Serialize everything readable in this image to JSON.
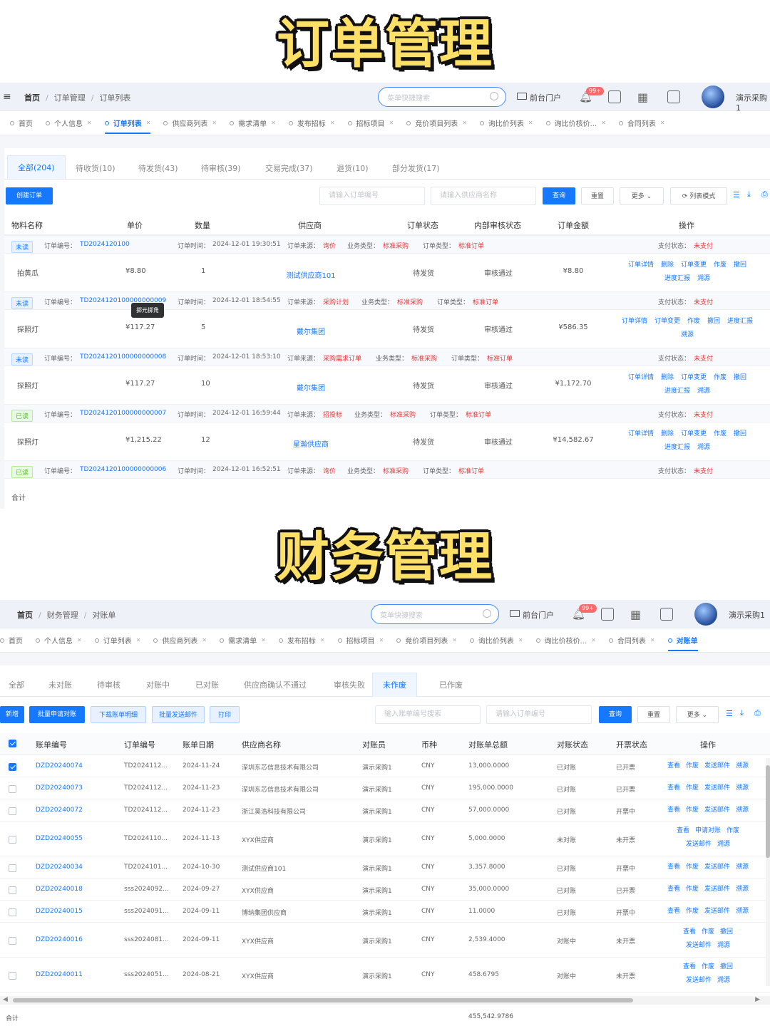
{
  "titles": {
    "order": "订单管理",
    "finance": "财务管理"
  },
  "order_panel": {
    "breadcrumb": [
      "首页",
      "订单管理",
      "订单列表"
    ],
    "search_placeholder": "菜单快捷搜索",
    "portal": "前台门户",
    "badge": "99+",
    "user": "演示采购1",
    "tabs": [
      {
        "label": "首页",
        "close": false
      },
      {
        "label": "个人信息",
        "close": true
      },
      {
        "label": "订单列表",
        "close": true,
        "active": true
      },
      {
        "label": "供应商列表",
        "close": true
      },
      {
        "label": "需求清单",
        "close": true
      },
      {
        "label": "发布招标",
        "close": true
      },
      {
        "label": "招标项目",
        "close": true
      },
      {
        "label": "竞价项目列表",
        "close": true
      },
      {
        "label": "询比价列表",
        "close": true
      },
      {
        "label": "询比价核价...",
        "close": true
      },
      {
        "label": "合同列表",
        "close": true
      }
    ],
    "status_tabs": [
      "全部(204)",
      "待收货(10)",
      "待发货(43)",
      "待审核(39)",
      "交易完成(37)",
      "退货(10)",
      "部分发货(17)"
    ],
    "create_btn": "创建订单",
    "order_no_placeholder": "请输入订单编号",
    "supplier_placeholder": "请输入供应商名称",
    "query": "查询",
    "reset": "重置",
    "more": "更多",
    "list_mode": "列表模式",
    "headers": [
      "物料名称",
      "单价",
      "数量",
      "供应商",
      "订单状态",
      "内部审核状态",
      "订单金额",
      "操作"
    ],
    "tooltip": "掷元掷角",
    "orders": [
      {
        "read_tag": "未读",
        "read": false,
        "order_no_label": "订单编号：",
        "order_no": "TD2024120100",
        "time_label": "订单时间：",
        "time": "2024-12-01 19:30:51",
        "source_label": "订单来源：",
        "source": "询价",
        "biz_label": "业务类型：",
        "biz": "标准采购",
        "type_label": "订单类型：",
        "type": "标准订单",
        "pay_label": "支付状态：",
        "pay": "未支付",
        "item": "拍黄瓜",
        "price": "¥8.80",
        "qty": "1",
        "supplier": "测试供应商101",
        "status": "待发货",
        "audit": "审核通过",
        "amount": "¥8.80",
        "ops": [
          [
            "订单详情",
            "删除",
            "订单变更",
            "作废",
            "撤回"
          ],
          [
            "进度汇报",
            "溯源"
          ]
        ]
      },
      {
        "read_tag": "未读",
        "read": false,
        "order_no_label": "订单编号：",
        "order_no": "TD2024120100000000009",
        "time_label": "订单时间：",
        "time": "2024-12-01 18:54:55",
        "source_label": "订单来源：",
        "source": "采购计划",
        "biz_label": "业务类型：",
        "biz": "标准采购",
        "type_label": "订单类型：",
        "type": "标准订单",
        "pay_label": "支付状态：",
        "pay": "未支付",
        "item": "探照灯",
        "price": "¥117.27",
        "qty": "5",
        "supplier": "戴尔集团",
        "status": "待发货",
        "audit": "审核通过",
        "amount": "¥586.35",
        "ops": [
          [
            "订单详情",
            "订单变更",
            "作废",
            "撤回",
            "进度汇报"
          ],
          [
            "溯源"
          ]
        ]
      },
      {
        "read_tag": "未读",
        "read": false,
        "order_no_label": "订单编号：",
        "order_no": "TD2024120100000000008",
        "time_label": "订单时间：",
        "time": "2024-12-01 18:53:10",
        "source_label": "订单来源：",
        "source": "采购需求订单",
        "biz_label": "业务类型：",
        "biz": "标准采购",
        "type_label": "订单类型：",
        "type": "标准订单",
        "pay_label": "支付状态：",
        "pay": "未支付",
        "item": "探照灯",
        "price": "¥117.27",
        "qty": "10",
        "supplier": "戴尔集团",
        "status": "待发货",
        "audit": "审核通过",
        "amount": "¥1,172.70",
        "ops": [
          [
            "订单详情",
            "删除",
            "订单变更",
            "作废",
            "撤回"
          ],
          [
            "进度汇报",
            "溯源"
          ]
        ]
      },
      {
        "read_tag": "已读",
        "read": true,
        "order_no_label": "订单编号：",
        "order_no": "TD2024120100000000007",
        "time_label": "订单时间：",
        "time": "2024-12-01 16:59:44",
        "source_label": "订单来源：",
        "source": "招投标",
        "biz_label": "业务类型：",
        "biz": "标准采购",
        "type_label": "订单类型：",
        "type": "标准订单",
        "pay_label": "支付状态：",
        "pay": "未支付",
        "item": "探照灯",
        "price": "¥1,215.22",
        "qty": "12",
        "supplier": "星瀚供应商",
        "status": "待发货",
        "audit": "审核通过",
        "amount": "¥14,582.67",
        "ops": [
          [
            "订单详情",
            "删除",
            "订单变更",
            "作废",
            "撤回"
          ],
          [
            "进度汇报",
            "溯源"
          ]
        ]
      },
      {
        "read_tag": "已读",
        "read": true,
        "order_no_label": "订单编号：",
        "order_no": "TD2024120100000000006",
        "time_label": "订单时间：",
        "time": "2024-12-01 16:52:51",
        "source_label": "订单来源：",
        "source": "询价",
        "biz_label": "业务类型：",
        "biz": "标准采购",
        "type_label": "订单类型：",
        "type": "标准订单",
        "pay_label": "支付状态：",
        "pay": "未支付"
      }
    ],
    "total_label": "合计"
  },
  "finance_panel": {
    "breadcrumb": [
      "首页",
      "财务管理",
      "对账单"
    ],
    "search_placeholder": "菜单快捷搜索",
    "portal": "前台门户",
    "badge": "99+",
    "user": "演示采购1",
    "tabs": [
      {
        "label": "首页",
        "close": false
      },
      {
        "label": "个人信息",
        "close": true
      },
      {
        "label": "订单列表",
        "close": true
      },
      {
        "label": "供应商列表",
        "close": true
      },
      {
        "label": "需求清单",
        "close": true
      },
      {
        "label": "发布招标",
        "close": true
      },
      {
        "label": "招标项目",
        "close": true
      },
      {
        "label": "竞价项目列表",
        "close": true
      },
      {
        "label": "询比价列表",
        "close": true
      },
      {
        "label": "询比价核价...",
        "close": true
      },
      {
        "label": "合同列表",
        "close": true
      },
      {
        "label": "对账单",
        "close": false,
        "active": true
      }
    ],
    "status_tabs": [
      "全部",
      "未对账",
      "待审核",
      "对账中",
      "已对账",
      "供应商确认不通过",
      "审核失败",
      "未作废",
      "已作废"
    ],
    "active_status": 7,
    "buttons": [
      "新增",
      "批量申请对账",
      "下载账单明细",
      "批量发送邮件",
      "打印"
    ],
    "bill_placeholder": "输入账单编号搜索",
    "order_placeholder": "请输入订单编号",
    "query": "查询",
    "reset": "重置",
    "more": "更多",
    "headers": [
      "账单编号",
      "订单编号",
      "账单日期",
      "供应商名称",
      "对账员",
      "币种",
      "对账单总额",
      "对账状态",
      "开票状态",
      "操作"
    ],
    "rows": [
      {
        "checked": true,
        "bill": "DZD20240074",
        "order": "TD2024112...",
        "date": "2024-11-24",
        "supplier": "深圳东芯信息技术有限公司",
        "clerk": "演示采购1",
        "currency": "CNY",
        "total": "13,000.0000",
        "recon": "已对账",
        "invoice": "已开票",
        "ops": [
          [
            "查看",
            "作废",
            "发送邮件",
            "溯源"
          ]
        ]
      },
      {
        "checked": false,
        "bill": "DZD20240073",
        "order": "TD2024112...",
        "date": "2024-11-23",
        "supplier": "深圳东芯信息技术有限公司",
        "clerk": "演示采购1",
        "currency": "CNY",
        "total": "195,000.0000",
        "recon": "已对账",
        "invoice": "已开票",
        "ops": [
          [
            "查看",
            "作废",
            "发送邮件",
            "溯源"
          ]
        ]
      },
      {
        "checked": false,
        "bill": "DZD20240072",
        "order": "TD2024112...",
        "date": "2024-11-23",
        "supplier": "浙江昊浩科技有限公司",
        "clerk": "演示采购1",
        "currency": "CNY",
        "total": "57,000.0000",
        "recon": "已对账",
        "invoice": "开票中",
        "ops": [
          [
            "查看",
            "作废",
            "发送邮件",
            "溯源"
          ]
        ]
      },
      {
        "checked": false,
        "bill": "DZD20240055",
        "order": "TD2024110...",
        "date": "2024-11-13",
        "supplier": "XYX供应商",
        "clerk": "演示采购1",
        "currency": "CNY",
        "total": "5,000.0000",
        "recon": "未对账",
        "invoice": "未开票",
        "ops": [
          [
            "查看",
            "申请对账",
            "作废"
          ],
          [
            "发送邮件",
            "溯源"
          ]
        ]
      },
      {
        "checked": false,
        "bill": "DZD20240034",
        "order": "TD2024101...",
        "date": "2024-10-30",
        "supplier": "测试供应商101",
        "clerk": "演示采购1",
        "currency": "CNY",
        "total": "3,357.8000",
        "recon": "已对账",
        "invoice": "开票中",
        "ops": [
          [
            "查看",
            "作废",
            "发送邮件",
            "溯源"
          ]
        ]
      },
      {
        "checked": false,
        "bill": "DZD20240018",
        "order": "sss2024092...",
        "date": "2024-09-27",
        "supplier": "XYX供应商",
        "clerk": "演示采购1",
        "currency": "CNY",
        "total": "35,000.0000",
        "recon": "已对账",
        "invoice": "已开票",
        "ops": [
          [
            "查看",
            "作废",
            "发送邮件",
            "溯源"
          ]
        ]
      },
      {
        "checked": false,
        "bill": "DZD20240015",
        "order": "sss2024091...",
        "date": "2024-09-11",
        "supplier": "博纳集团供应商",
        "clerk": "演示采购1",
        "currency": "CNY",
        "total": "11.0000",
        "recon": "已对账",
        "invoice": "开票中",
        "ops": [
          [
            "查看",
            "作废",
            "发送邮件",
            "溯源"
          ]
        ]
      },
      {
        "checked": false,
        "bill": "DZD20240016",
        "order": "sss2024081...",
        "date": "2024-09-11",
        "supplier": "XYX供应商",
        "clerk": "演示采购1",
        "currency": "CNY",
        "total": "2,539.4000",
        "recon": "对账中",
        "invoice": "未开票",
        "ops": [
          [
            "查看",
            "作废",
            "撤回"
          ],
          [
            "发送邮件",
            "溯源"
          ]
        ]
      },
      {
        "checked": false,
        "bill": "DZD20240011",
        "order": "sss2024051...",
        "date": "2024-08-21",
        "supplier": "XYX供应商",
        "clerk": "演示采购1",
        "currency": "CNY",
        "total": "458.6795",
        "recon": "对账中",
        "invoice": "未开票",
        "ops": [
          [
            "查看",
            "作废",
            "撤回"
          ],
          [
            "发送邮件",
            "溯源"
          ]
        ]
      }
    ],
    "total_label": "合计",
    "total_value": "455,542.9786"
  },
  "colors": {
    "primary": "#1677ff",
    "title_yellow": "#FFE066",
    "red": "#f23030",
    "green": "#52c41a"
  }
}
